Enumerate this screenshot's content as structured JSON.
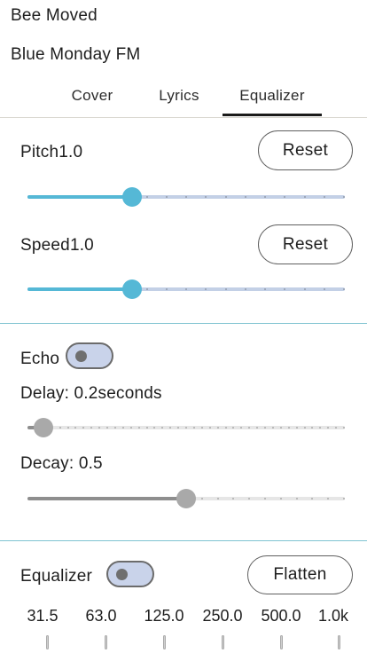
{
  "header": {
    "track_title": "Bee Moved",
    "station": "Blue Monday FM"
  },
  "tabs": [
    {
      "label": "Cover",
      "selected": false
    },
    {
      "label": "Lyrics",
      "selected": false
    },
    {
      "label": "Equalizer",
      "selected": true
    }
  ],
  "playback": {
    "pitch_label": "Pitch1.0",
    "pitch_value": 1.0,
    "pitch_slider_fraction": 0.33,
    "speed_label": "Speed1.0",
    "speed_value": 1.0,
    "speed_slider_fraction": 0.33,
    "reset_label": "Reset"
  },
  "echo": {
    "label": "Echo",
    "enabled": false,
    "delay_label": "Delay: 0.2seconds",
    "delay_slider_fraction": 0.05,
    "decay_label": "Decay: 0.5",
    "decay_slider_fraction": 0.5
  },
  "equalizer": {
    "label": "Equalizer",
    "enabled": false,
    "flatten_label": "Flatten",
    "bands": [
      "31.5",
      "63.0",
      "125.0",
      "250.0",
      "500.0",
      "1.0k"
    ]
  },
  "colors": {
    "accent": "#55b8d6",
    "accent_track_inactive": "#c3d0e6",
    "gray_thumb": "#a9a9a9",
    "gray_track_active": "#8e8e8e",
    "gray_track_inactive": "#e6e6e6",
    "toggle_bg": "#c9d3ea",
    "section_divider": "#7fc3d1"
  }
}
